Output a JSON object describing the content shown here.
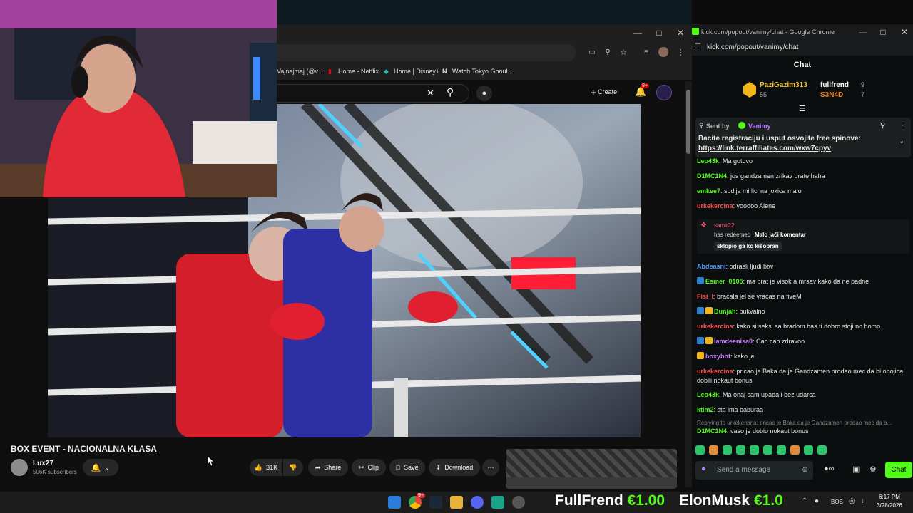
{
  "chat_window": {
    "title": "kick.com/popout/vanimy/chat - Google Chrome",
    "url": "kick.com/popout/vanimy/chat",
    "header": "Chat",
    "leaderboard": [
      {
        "name": "PaziGazim313",
        "value": "55"
      },
      {
        "name": "fullfrend",
        "value": "9"
      },
      {
        "name": "S3N4D",
        "value": "7"
      }
    ],
    "pinned": {
      "sent_by_label": "Sent by",
      "sender": "Vanimy",
      "text": "Bacite registraciju i usput osvojite free spinove:",
      "link": "https://link.terraffiliates.com/wxw7cpyv"
    },
    "messages": [
      {
        "user": "Leo43k",
        "color": "#53fc18",
        "text": ": Ma gotovo"
      },
      {
        "user": "D1MC1N4",
        "color": "#53fc18",
        "text": ": jos gandzamen zrikav brate haha"
      },
      {
        "user": "emkee7",
        "color": "#53fc18",
        "text": ": sudija mi lici na jokica malo"
      },
      {
        "user": "urkekercina",
        "color": "#ff4d4d",
        "text": ": yooooo Alene"
      },
      {
        "user": "Abdeasni",
        "color": "#4d9bff",
        "text": ": odrasli ljudi btw"
      },
      {
        "user": "Esmer_0105",
        "color": "#53fc18",
        "text": ": ma brat je visok a mrsav kako da ne padne"
      },
      {
        "user": "Fisi_l",
        "color": "#ff4d4d",
        "text": ": bracala jel se vracas na fiveM"
      },
      {
        "user": "Dunjah",
        "color": "#53fc18",
        "text": ": bukvalno"
      },
      {
        "user": "urkekercina",
        "color": "#ff4d4d",
        "text": ": kako si seksi sa bradom bas ti dobro stoji no homo"
      },
      {
        "user": "lamdeenisa0",
        "color": "#c77dff",
        "text": ": Cao cao zdravoo"
      },
      {
        "user": "boxybot",
        "color": "#c77dff",
        "text": ": kako je"
      },
      {
        "user": "urkekercina",
        "color": "#ff4d4d",
        "text": ": pricao je Baka da je Gandzamen prodao mec da bi obojica dobili nokaut bonus"
      },
      {
        "user": "Leo43k",
        "color": "#53fc18",
        "text": ": Ma onaj sam upada i bez udarca"
      },
      {
        "user": "ktim2",
        "color": "#53fc18",
        "text": ": sta ima baburaa"
      },
      {
        "user": "D1MC1N4",
        "color": "#53fc18",
        "text": ": vaso je dobio nokaut bonus"
      }
    ],
    "redeem": {
      "user": "samir22",
      "text": "has redeemed",
      "reward": "Malo jači komentar",
      "message": "sklopio ga ko kišobran"
    },
    "reply_hint": "Replying to urkekercina: pricao je Baka da je Gandzamen prodao mec da b...",
    "input_placeholder": "Send a message",
    "send_label": "Chat"
  },
  "youtube": {
    "bookmarks": [
      "Vajnajmaj (@v...",
      "Home - Netflix",
      "Home | Disney+",
      "Watch Tokyo Ghoul..."
    ],
    "create_label": "Create",
    "notif_count": "9+",
    "video_title": "BOX EVENT - NACIONALNA KLASA",
    "channel": "Lux27",
    "subscribers": "506K subscribers",
    "likes": "31K",
    "share_label": "Share",
    "clip_label": "Clip",
    "save_label": "Save",
    "download_label": "Download"
  },
  "taskbar": {
    "ticker": [
      {
        "name": "FullFrend",
        "amount": "€1.00"
      },
      {
        "name": "ElonMusk",
        "amount": "€1.0"
      }
    ],
    "lang": "BOS",
    "time": "6:17 PM",
    "date": "3/28/2026",
    "chrome_badge": "9+"
  },
  "colors": {
    "kick_green": "#53fc18",
    "yt_bg": "#0f0f0f",
    "chat_bg": "#0b0e0f",
    "red_notif": "#cc0000"
  }
}
